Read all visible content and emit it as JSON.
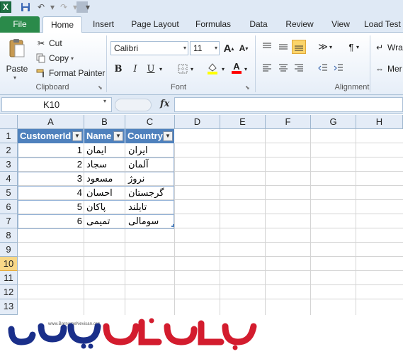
{
  "qat": {
    "app_logo": "X",
    "icons": [
      "save-icon",
      "undo-icon",
      "redo-icon",
      "customize-icon"
    ]
  },
  "tabs": [
    "File",
    "Home",
    "Insert",
    "Page Layout",
    "Formulas",
    "Data",
    "Review",
    "View",
    "Load Test"
  ],
  "clipboard": {
    "paste": "Paste",
    "cut": "Cut",
    "copy": "Copy",
    "format_painter": "Format Painter",
    "label": "Clipboard"
  },
  "font": {
    "name": "Calibri",
    "size": "11",
    "label": "Font",
    "bold": "B",
    "italic": "I",
    "underline": "U",
    "fill_color": "#ffff00",
    "font_color": "#ff0000"
  },
  "alignment": {
    "label": "Alignment",
    "wrap": "Wra",
    "merge": "Mer"
  },
  "formula_bar": {
    "name_box": "K10",
    "fx": "fx",
    "value": ""
  },
  "grid": {
    "columns": [
      "A",
      "B",
      "C",
      "D",
      "E",
      "F",
      "G",
      "H"
    ],
    "rows": [
      "1",
      "2",
      "3",
      "4",
      "5",
      "6",
      "7",
      "8",
      "9",
      "10",
      "11",
      "12",
      "13"
    ],
    "selected_row": "10"
  },
  "table": {
    "headers": [
      "CustomerId",
      "Name",
      "Country"
    ],
    "rows": [
      {
        "id": "1",
        "name": "ایمان",
        "country": "ایران"
      },
      {
        "id": "2",
        "name": "سجاد",
        "country": "آلمان"
      },
      {
        "id": "3",
        "name": "مسعود",
        "country": "نروژ"
      },
      {
        "id": "4",
        "name": "احسان",
        "country": "گرجستان"
      },
      {
        "id": "5",
        "name": "پاکان",
        "country": "تایلند"
      },
      {
        "id": "6",
        "name": "تمیمی",
        "country": "سومالی"
      }
    ],
    "header_color": "#4f81bd"
  },
  "watermark": {
    "url": "www.BarnameNevisan.org"
  }
}
